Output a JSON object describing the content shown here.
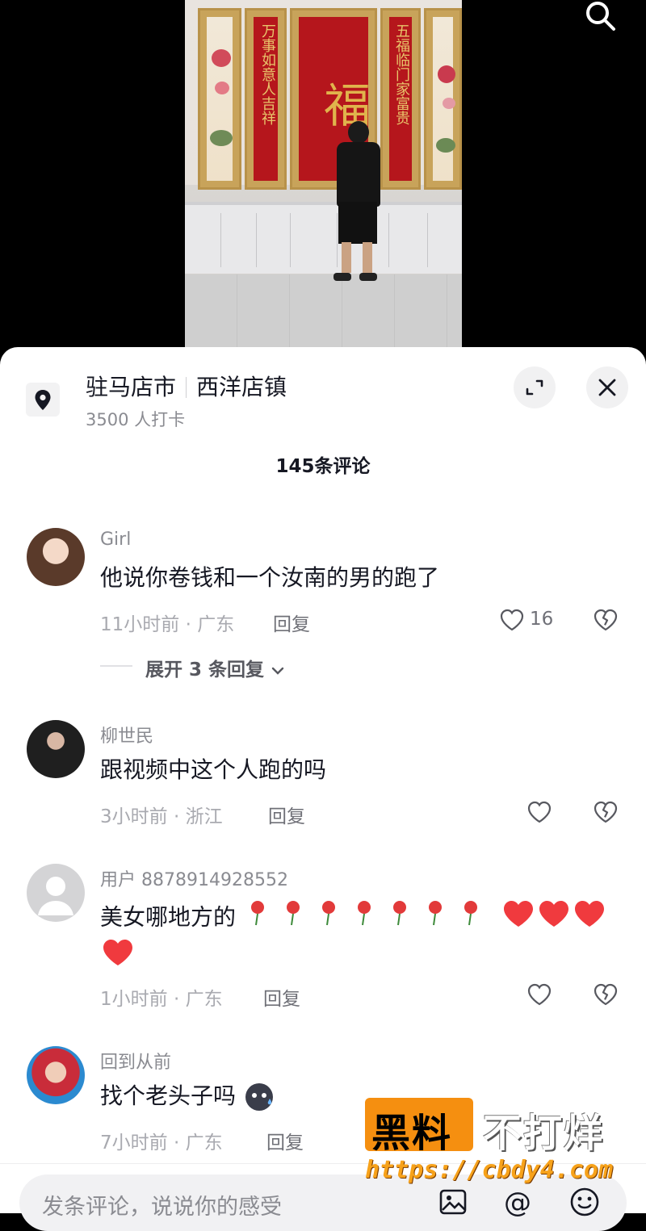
{
  "video": {
    "couplet_left": "万事如意人吉祥",
    "couplet_right": "五福临门家富贵",
    "center_char": "福"
  },
  "location": {
    "city": "驻马店市",
    "town": "西洋店镇",
    "checkins": "3500 人打卡"
  },
  "comment_count": "145条评论",
  "comments": [
    {
      "user": "Girl",
      "text": "他说你卷钱和一个汝南的男的跑了",
      "meta": "11小时前 · 广东",
      "reply": "回复",
      "likes": "16",
      "expand": "展开 3 条回复"
    },
    {
      "user": "柳世民",
      "text": "跟视频中这个人跑的吗",
      "meta": "3小时前 · 浙江",
      "reply": "回复"
    },
    {
      "user": "用户 8878914928552",
      "text": "美女哪地方的",
      "meta": "1小时前 · 广东",
      "reply": "回复"
    },
    {
      "user": "回到从前",
      "text": "找个老头子吗",
      "meta": "7小时前 · 广东",
      "reply": "回复"
    }
  ],
  "input": {
    "placeholder": "发条评论，说说你的感受"
  },
  "watermark": {
    "brand_a": "黑料",
    "brand_b": "不打烊",
    "url": "https://cbdy4.com"
  },
  "colors": {
    "accent_orange": "#f58f10",
    "text_primary": "#161823",
    "text_secondary": "#8a8b91"
  }
}
